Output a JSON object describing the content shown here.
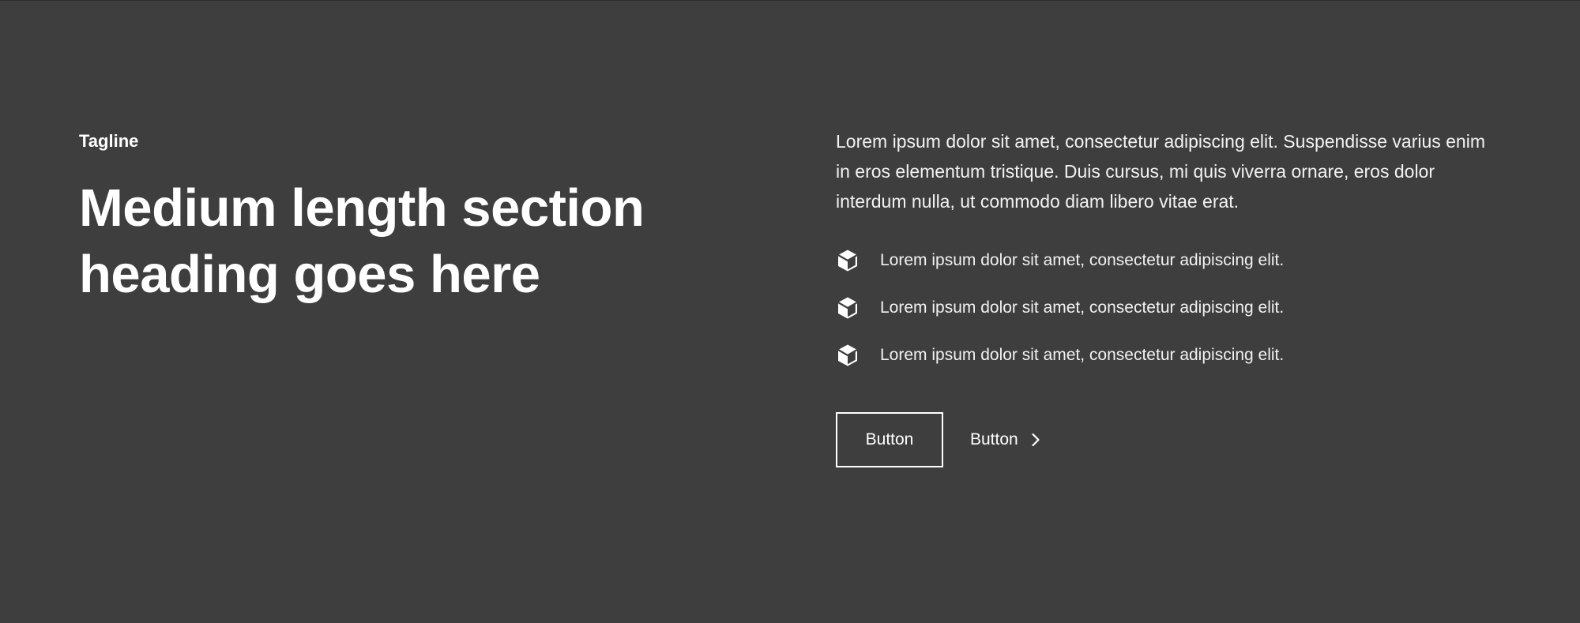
{
  "section": {
    "tagline": "Tagline",
    "heading": "Medium length section heading goes here",
    "intro": "Lorem ipsum dolor sit amet, consectetur adipiscing elit. Suspendisse varius enim in eros elementum tristique. Duis cursus, mi quis viverra ornare, eros dolor interdum nulla, ut commodo diam libero vitae erat.",
    "features": [
      {
        "icon": "cube-icon",
        "text": "Lorem ipsum dolor sit amet, consectetur adipiscing elit."
      },
      {
        "icon": "cube-icon",
        "text": "Lorem ipsum dolor sit amet, consectetur adipiscing elit."
      },
      {
        "icon": "cube-icon",
        "text": "Lorem ipsum dolor sit amet, consectetur adipiscing elit."
      }
    ],
    "primary_button": "Button",
    "secondary_button": "Button",
    "secondary_button_icon": "chevron-right-icon"
  },
  "colors": {
    "background": "#3e3e3e",
    "text": "#ffffff"
  }
}
